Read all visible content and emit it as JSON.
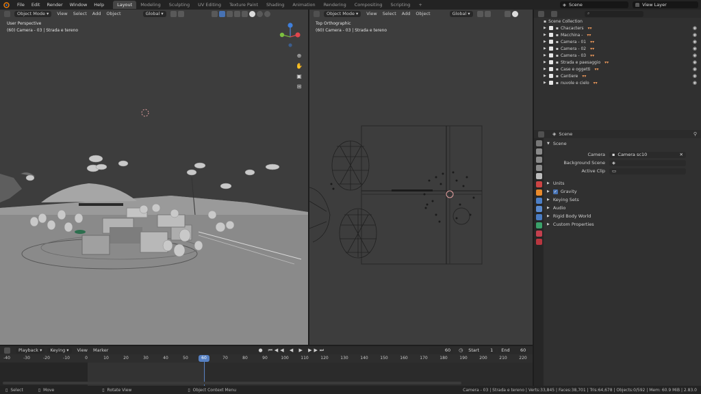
{
  "menubar": {
    "items": [
      "File",
      "Edit",
      "Render",
      "Window",
      "Help"
    ],
    "workspaces": [
      "Layout",
      "Modeling",
      "Sculpting",
      "UV Editing",
      "Texture Paint",
      "Shading",
      "Animation",
      "Rendering",
      "Compositing",
      "Scripting"
    ],
    "active_workspace": "Layout",
    "add_tab": "+",
    "scene": "Scene",
    "view_layer": "View Layer"
  },
  "viewport_left": {
    "mode": "Object Mode",
    "menus": [
      "View",
      "Select",
      "Add",
      "Object"
    ],
    "orientation": "Global",
    "title": "User Perspective",
    "subtitle": "(60) Camera - 03 | Strada e tereno"
  },
  "viewport_right": {
    "mode": "Object Mode",
    "menus": [
      "View",
      "Select",
      "Add",
      "Object"
    ],
    "orientation": "Global",
    "title": "Top Orthographic",
    "subtitle": "(60) Camera - 03 | Strada e tereno"
  },
  "outliner": {
    "root": "Scene Collection",
    "collections": [
      {
        "label": "Chacacters"
      },
      {
        "label": "Macchina -"
      },
      {
        "label": "Camera - 01"
      },
      {
        "label": "Camera - 02"
      },
      {
        "label": "Camera - 03"
      },
      {
        "label": "Strada e paesaggio"
      },
      {
        "label": "Case e oggetti"
      },
      {
        "label": "Cantiere"
      },
      {
        "label": "nuvole e cielo"
      }
    ]
  },
  "properties": {
    "breadcrumb": "Scene",
    "panel_title": "Scene",
    "camera_label": "Camera",
    "camera_value": "Camera sc10",
    "background_scene_label": "Background Scene",
    "active_clip_label": "Active Clip",
    "sections": [
      "Units",
      "Gravity",
      "Keying Sets",
      "Audio",
      "Rigid Body World",
      "Custom Properties"
    ],
    "gravity_checked": true
  },
  "timeline": {
    "menus": [
      "Playback",
      "Keying",
      "View",
      "Marker"
    ],
    "current_frame": "60",
    "start_label": "Start",
    "start_value": "1",
    "end_label": "End",
    "end_value": "60",
    "ticks": [
      "-40",
      "-30",
      "-20",
      "-10",
      "0",
      "10",
      "20",
      "30",
      "40",
      "50",
      "60",
      "70",
      "80",
      "90",
      "100",
      "110",
      "120",
      "130",
      "140",
      "150",
      "160",
      "170",
      "180",
      "190",
      "200",
      "210",
      "220"
    ]
  },
  "statusbar": {
    "select": "Select",
    "move": "Move",
    "rotate": "Rotate View",
    "context": "Object Context Menu",
    "stats": "Camera - 03 | Strada e tereno | Verts:33,845 | Faces:38,701 | Tris:64,678 | Objects:0/592 | Mem: 60.9 MiB | 2.83.0"
  },
  "colors": {
    "accent_blue": "#4772b3",
    "viewport_bg": "#3d3d3d",
    "panel_bg": "#303030",
    "header_bg": "#2b2b2b",
    "playhead": "#5680c2"
  },
  "icons": [
    "blender-logo-icon",
    "search-icon",
    "eye-icon",
    "checkbox-icon",
    "zoom-icon",
    "hand-icon",
    "camera-icon",
    "grid-icon",
    "play-icon",
    "record-icon",
    "clock-icon",
    "pin-icon"
  ]
}
